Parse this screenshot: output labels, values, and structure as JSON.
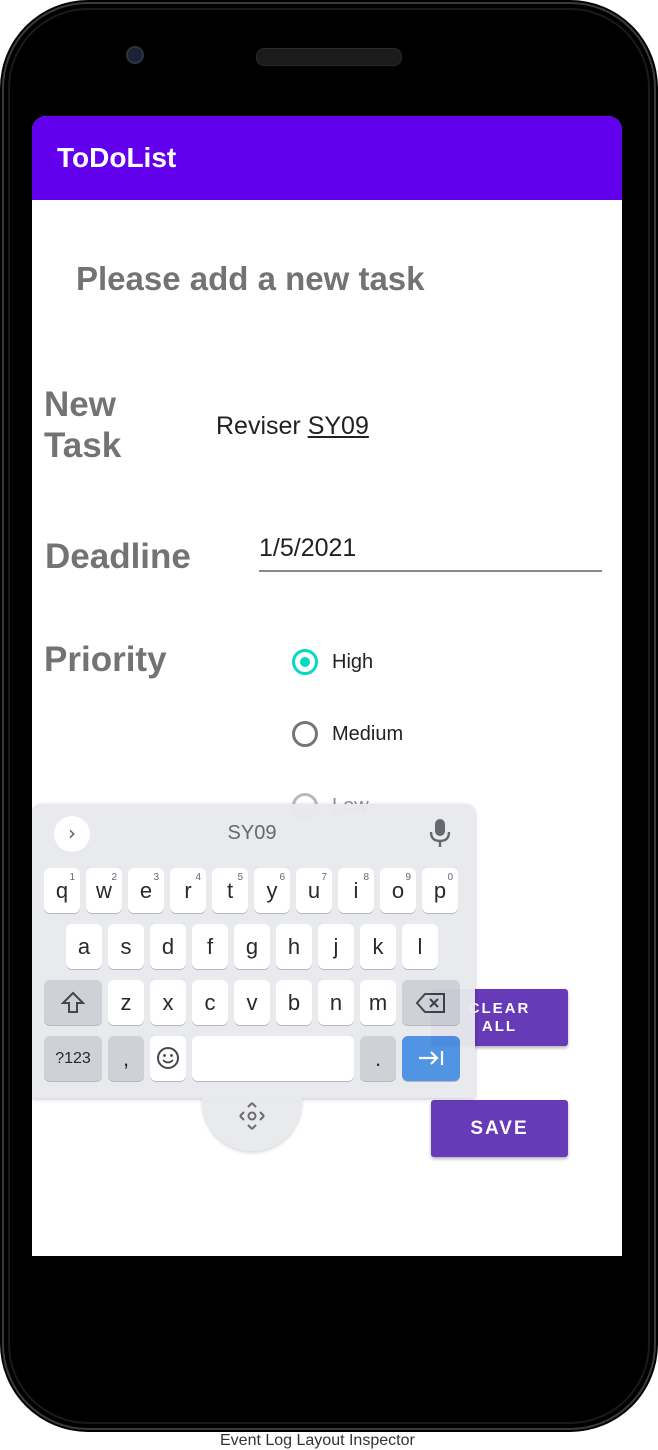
{
  "app": {
    "title": "ToDoList"
  },
  "form": {
    "heading": "Please add a new task",
    "new_task_label": "New Task",
    "new_task_value_prefix": "Reviser ",
    "new_task_value_suggestion": "SY09",
    "deadline_label": "Deadline",
    "deadline_value": "1/5/2021",
    "priority_label": "Priority",
    "priority_options": [
      {
        "label": "High",
        "selected": true
      },
      {
        "label": "Medium",
        "selected": false
      },
      {
        "label": "Low",
        "selected": false
      }
    ],
    "clear_all_line1": "CLEAR",
    "clear_all_line2": "ALL",
    "save_label": "SAVE"
  },
  "keyboard": {
    "suggestion": "SY09",
    "row1": [
      {
        "k": "q",
        "hint": "1"
      },
      {
        "k": "w",
        "hint": "2"
      },
      {
        "k": "e",
        "hint": "3"
      },
      {
        "k": "r",
        "hint": "4"
      },
      {
        "k": "t",
        "hint": "5"
      },
      {
        "k": "y",
        "hint": "6"
      },
      {
        "k": "u",
        "hint": "7"
      },
      {
        "k": "i",
        "hint": "8"
      },
      {
        "k": "o",
        "hint": "9"
      },
      {
        "k": "p",
        "hint": "0"
      }
    ],
    "row2": [
      "a",
      "s",
      "d",
      "f",
      "g",
      "h",
      "j",
      "k",
      "l"
    ],
    "row3": [
      "z",
      "x",
      "c",
      "v",
      "b",
      "n",
      "m"
    ],
    "symbols_label": "?123",
    "comma_label": ",",
    "period_label": "."
  },
  "bottom_bar": {
    "text": "Event Log      Layout Inspector"
  },
  "colors": {
    "app_bar": "#6200ee",
    "button": "#673ab7",
    "radio_selected": "#03dac5"
  }
}
